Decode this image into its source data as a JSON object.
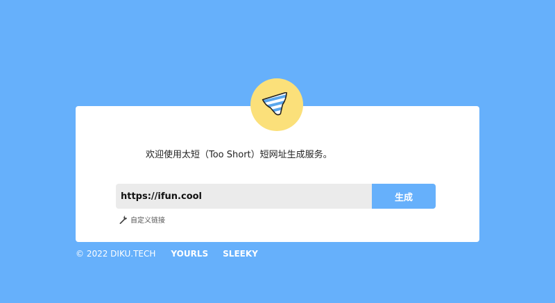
{
  "card": {
    "welcome_text": "欢迎使用太短（Too Short）短网址生成服务。",
    "logo_icon": "striped-briefs-icon",
    "url_input": {
      "value": "https://ifun.cool",
      "placeholder": ""
    },
    "generate_label": "生成",
    "custom_link": {
      "icon": "wrench-icon",
      "label": "自定义链接"
    }
  },
  "footer": {
    "copyright": "© 2022 DIKU.TECH",
    "links": [
      {
        "label": "YOURLS"
      },
      {
        "label": "SLEEKY"
      }
    ]
  },
  "colors": {
    "background": "#66b0fb",
    "logo_circle": "#fbe07a",
    "button": "#66b0fb",
    "input_bg": "#ebebeb"
  }
}
